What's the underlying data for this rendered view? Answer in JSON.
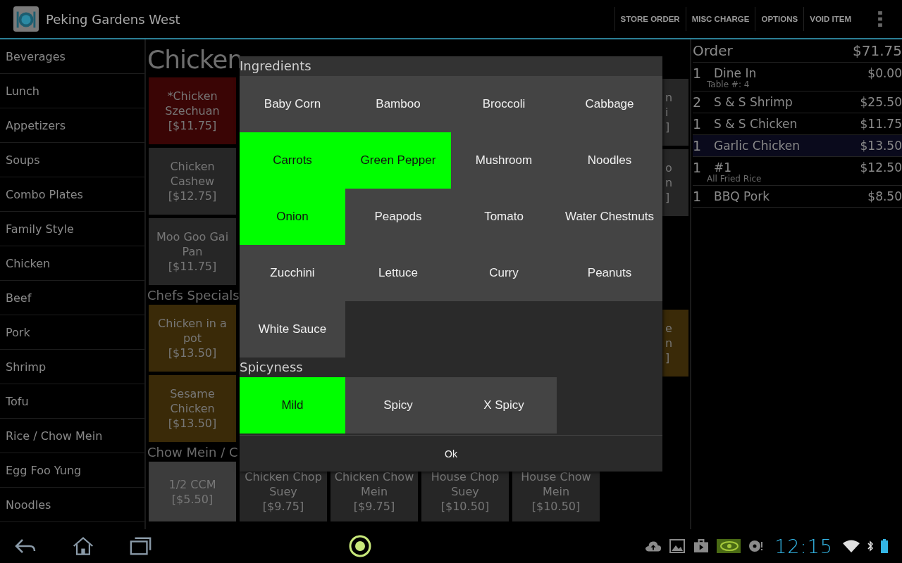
{
  "app_bar": {
    "title": "Peking Gardens West",
    "actions": [
      "STORE ORDER",
      "MISC CHARGE",
      "OPTIONS",
      "VOID ITEM"
    ]
  },
  "categories": [
    {
      "label": "Beverages",
      "selected": false
    },
    {
      "label": "Lunch",
      "selected": false
    },
    {
      "label": "Appetizers",
      "selected": false
    },
    {
      "label": "Soups",
      "selected": false
    },
    {
      "label": "Combo Plates",
      "selected": false
    },
    {
      "label": "Family Style",
      "selected": false
    },
    {
      "label": "Chicken",
      "selected": false
    },
    {
      "label": "Beef",
      "selected": false
    },
    {
      "label": "Pork",
      "selected": false
    },
    {
      "label": "Shrimp",
      "selected": false
    },
    {
      "label": "Tofu",
      "selected": false
    },
    {
      "label": "Rice / Chow Mein",
      "selected": false
    },
    {
      "label": "Egg Foo Yung",
      "selected": false
    },
    {
      "label": "Noodles",
      "selected": false
    }
  ],
  "menu": {
    "title": "Chicken",
    "sections": [
      {
        "items": [
          {
            "name": "*Chicken Szechuan",
            "price": "[$11.75]",
            "color": "#3a0505"
          },
          {
            "name": "Chicken Cashew",
            "price": "[$12.75]",
            "color": "#262626"
          },
          {
            "name": "Moo Goo Gai Pan",
            "price": "[$11.75]",
            "color": "#262626"
          }
        ]
      },
      {
        "heading": "Chefs Specials",
        "items": [
          {
            "name": "Chicken in a pot",
            "price": "[$13.50]",
            "color": "#3a2a08"
          },
          {
            "name": "Sesame Chicken",
            "price": "[$13.50]",
            "color": "#3a2a08"
          }
        ]
      },
      {
        "heading": "Chow Mein / C",
        "items": [
          {
            "name": "1/2 CCM",
            "price": "[$5.50]",
            "color": "#3c3c3c"
          },
          {
            "name": "Chicken Chop Suey",
            "price": "[$9.75]",
            "color": "#262626"
          },
          {
            "name": "Chicken Chow Mein",
            "price": "[$9.75]",
            "color": "#262626"
          },
          {
            "name": "House Chop Suey",
            "price": "[$10.50]",
            "color": "#262626"
          },
          {
            "name": "House Chow Mein",
            "price": "[$10.50]",
            "color": "#262626"
          }
        ]
      }
    ],
    "peeking_tiles": [
      {
        "lines": [
          "n",
          "i",
          "]"
        ],
        "color": "#262626"
      },
      {
        "lines": [
          "o",
          "n",
          "]"
        ],
        "color": "#262626"
      },
      {
        "lines": [
          "e",
          "n",
          "]"
        ],
        "color": "#3a2a08"
      }
    ]
  },
  "order": {
    "title": "Order",
    "total": "$71.75",
    "lines": [
      {
        "qty": "1",
        "name": "Dine In",
        "price": "$0.00",
        "note": "Table #: 4",
        "selected": false
      },
      {
        "qty": "2",
        "name": "S & S Shrimp",
        "price": "$25.50",
        "selected": false
      },
      {
        "qty": "1",
        "name": "S & S Chicken",
        "price": "$11.75",
        "selected": false
      },
      {
        "qty": "1",
        "name": "Garlic Chicken",
        "price": "$13.50",
        "selected": true
      },
      {
        "qty": "1",
        "name": "#1",
        "price": "$12.50",
        "note": "All Fried Rice",
        "selected": false
      },
      {
        "qty": "1",
        "name": "BBQ Pork",
        "price": "$8.50",
        "selected": false
      }
    ]
  },
  "dialog": {
    "groups": [
      {
        "title": "Ingredients",
        "options": [
          {
            "label": "Baby Corn",
            "selected": false
          },
          {
            "label": "Bamboo",
            "selected": false
          },
          {
            "label": "Broccoli",
            "selected": false
          },
          {
            "label": "Cabbage",
            "selected": false
          },
          {
            "label": "Carrots",
            "selected": true
          },
          {
            "label": "Green Pepper",
            "selected": true
          },
          {
            "label": "Mushroom",
            "selected": false
          },
          {
            "label": "Noodles",
            "selected": false
          },
          {
            "label": "Onion",
            "selected": true
          },
          {
            "label": "Peapods",
            "selected": false
          },
          {
            "label": "Tomato",
            "selected": false
          },
          {
            "label": "Water Chestnuts",
            "selected": false
          },
          {
            "label": "Zucchini",
            "selected": false
          },
          {
            "label": "Lettuce",
            "selected": false
          },
          {
            "label": "Curry",
            "selected": false
          },
          {
            "label": "Peanuts",
            "selected": false
          },
          {
            "label": "White Sauce",
            "selected": false
          }
        ]
      },
      {
        "title": "Spicyness",
        "options": [
          {
            "label": "Mild",
            "selected": true
          },
          {
            "label": "Spicy",
            "selected": false
          },
          {
            "label": "X Spicy",
            "selected": false
          }
        ]
      }
    ],
    "button": "Ok"
  },
  "status_bar": {
    "time": "12:15"
  }
}
